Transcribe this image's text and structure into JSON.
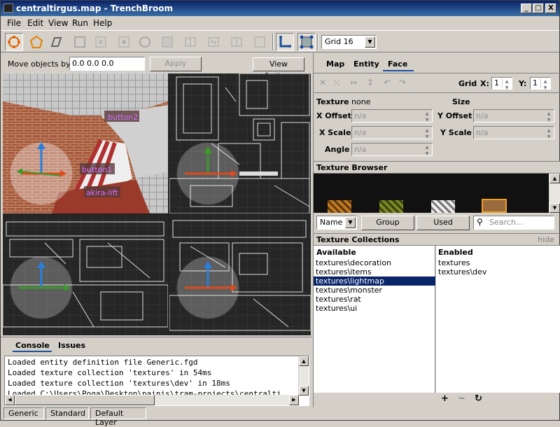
{
  "window": {
    "title": "centraltirgus.map - TrenchBroom",
    "controls": [
      "_",
      "□",
      "X"
    ]
  },
  "menubar": [
    "File",
    "Edit",
    "View",
    "Run",
    "Help"
  ],
  "toolbar": {
    "grid_select": "Grid 16"
  },
  "move_bar": {
    "label": "Move objects by",
    "value": "0.0 0.0 0.0",
    "apply": "Apply",
    "view_options": "View Options"
  },
  "viewport3d": {
    "labels": [
      "button2",
      "button1",
      "akira-lift"
    ]
  },
  "console": {
    "tabs": [
      "Console",
      "Issues"
    ],
    "lines": [
      "Loaded entity definition file Generic.fgd",
      "Loaded texture collection 'textures' in 54ms",
      "Loaded texture collection 'textures\\dev' in 18ms",
      "Loaded C:\\Users\\Poga\\Desktop\\painis\\tram-projects\\centralti"
    ]
  },
  "status": [
    "Generic",
    "Standard",
    "Default Layer"
  ],
  "inspector": {
    "tabs": [
      "Map",
      "Entity",
      "Face"
    ],
    "active_tab": "Face",
    "grid": {
      "label": "Grid",
      "x_label": "X:",
      "x": "1",
      "y_label": "Y:",
      "y": "1"
    },
    "face": {
      "texture_label": "Texture",
      "texture_value": "none",
      "size_label": "Size",
      "x_offset_label": "X Offset",
      "y_offset_label": "Y Offset",
      "x_scale_label": "X Scale",
      "y_scale_label": "Y Scale",
      "angle_label": "Angle",
      "na": "n/a"
    },
    "texture_browser": {
      "title": "Texture Browser",
      "sort": "Name",
      "group": "Group",
      "used": "Used",
      "search_placeholder": "Search..."
    },
    "collections": {
      "title": "Texture Collections",
      "hide": "hide",
      "available_label": "Available",
      "enabled_label": "Enabled",
      "available": [
        "textures\\decoration",
        "textures\\items",
        "textures\\lightmap",
        "textures\\monster",
        "textures\\rat",
        "textures\\ui"
      ],
      "selected": "textures\\lightmap",
      "enabled": [
        "textures",
        "textures\\dev"
      ],
      "buttons": [
        "+",
        "−",
        "↻"
      ]
    }
  }
}
